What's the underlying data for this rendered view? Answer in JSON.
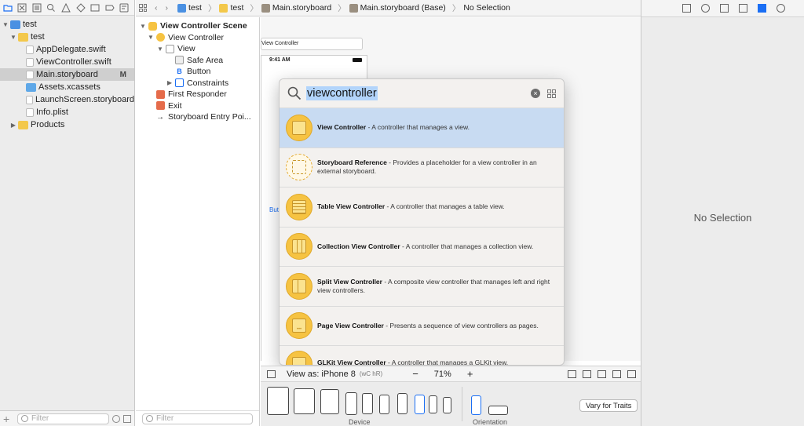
{
  "navigator": {
    "items": [
      {
        "label": "test",
        "depth": 0,
        "expanded": true,
        "icon": "project-icon"
      },
      {
        "label": "test",
        "depth": 1,
        "expanded": true,
        "icon": "folder-icon"
      },
      {
        "label": "AppDelegate.swift",
        "depth": 2,
        "icon": "swift-file-icon"
      },
      {
        "label": "ViewController.swift",
        "depth": 2,
        "icon": "swift-file-icon"
      },
      {
        "label": "Main.storyboard",
        "depth": 2,
        "icon": "storyboard-icon",
        "selected": true,
        "badge": "M"
      },
      {
        "label": "Assets.xcassets",
        "depth": 2,
        "icon": "assets-folder-icon"
      },
      {
        "label": "LaunchScreen.storyboard",
        "depth": 2,
        "icon": "storyboard-icon"
      },
      {
        "label": "Info.plist",
        "depth": 2,
        "icon": "plist-icon"
      },
      {
        "label": "Products",
        "depth": 1,
        "expanded": false,
        "icon": "folder-icon"
      }
    ],
    "filter_placeholder": "Filter"
  },
  "jumpbar": {
    "items": [
      "test",
      "test",
      "Main.storyboard",
      "Main.storyboard (Base)",
      "No Selection"
    ]
  },
  "outline": {
    "items": [
      {
        "label": "View Controller Scene",
        "bold": true
      },
      {
        "label": "View Controller"
      },
      {
        "label": "View"
      },
      {
        "label": "Safe Area"
      },
      {
        "label": "Button"
      },
      {
        "label": "Constraints"
      },
      {
        "label": "First Responder"
      },
      {
        "label": "Exit"
      },
      {
        "label": "Storyboard Entry Poi..."
      }
    ],
    "filter_placeholder": "Filter"
  },
  "canvas": {
    "scene_title": "View Controller",
    "status_time": "9:41 AM",
    "button_label": "Butt"
  },
  "library": {
    "query": "viewcontroller",
    "items": [
      {
        "name": "View Controller",
        "desc": " - A controller that manages a view.",
        "selected": true
      },
      {
        "name": "Storyboard Reference",
        "desc": " - Provides a placeholder for a view controller in an external storyboard."
      },
      {
        "name": "Table View Controller",
        "desc": " - A controller that manages a table view."
      },
      {
        "name": "Collection View Controller",
        "desc": " - A controller that manages a collection view."
      },
      {
        "name": "Split View Controller",
        "desc": " - A composite view controller that manages left and right view controllers."
      },
      {
        "name": "Page View Controller",
        "desc": " - Presents a sequence of view controllers as pages."
      },
      {
        "name": "GLKit View Controller",
        "desc": " - A controller that manages a GLKit view."
      }
    ]
  },
  "config_bar": {
    "view_as": "View as: iPhone 8",
    "traits": "(wC hR)",
    "zoom_minus": "−",
    "zoom": "71%",
    "zoom_plus": "+"
  },
  "device_bar": {
    "device_label": "Device",
    "orientation_label": "Orientation",
    "vary_label": "Vary for Traits"
  },
  "inspector": {
    "no_selection": "No Selection"
  },
  "colors": {
    "selection_blue": "#c8dbf2",
    "search_highlight": "#b2d4fb",
    "icon_yellow": "#f6c342",
    "accent": "#1a6ef4"
  }
}
